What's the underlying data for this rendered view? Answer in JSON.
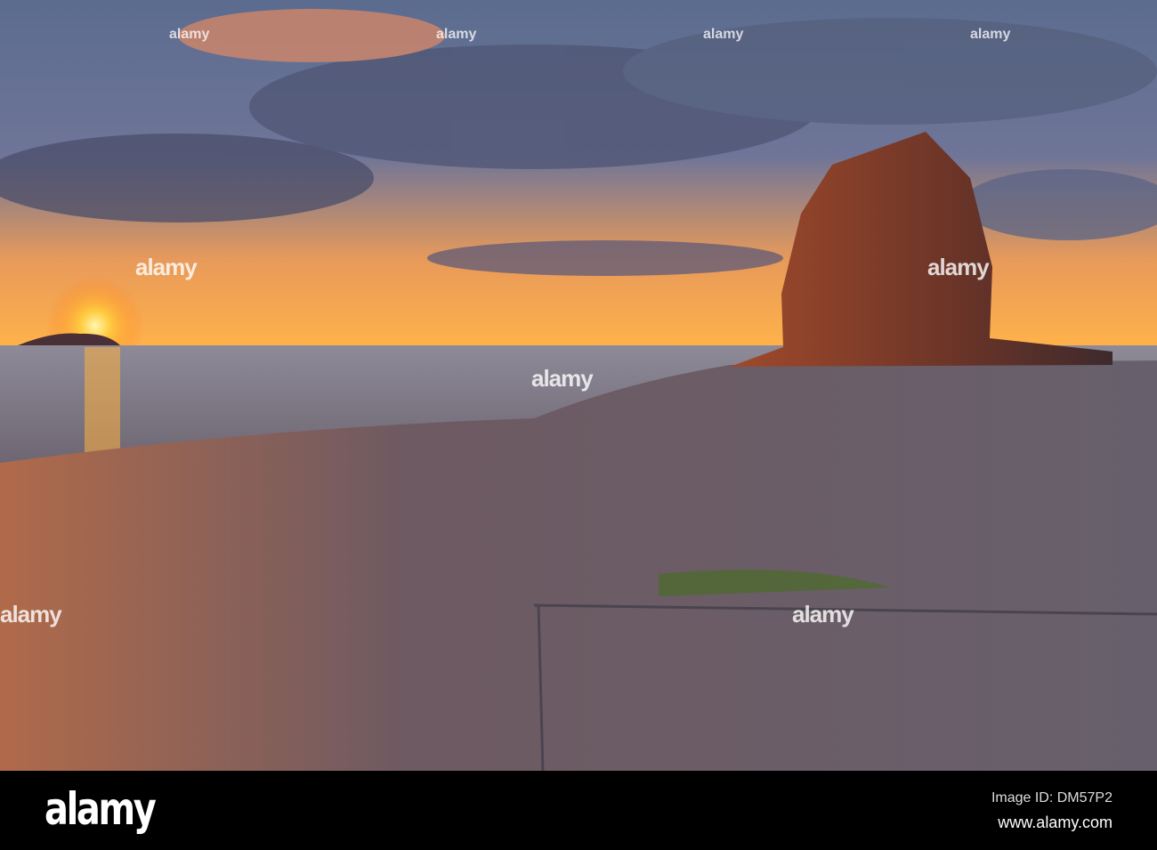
{
  "footer": {
    "logo": "alamy",
    "image_id": "Image ID: DM57P2",
    "website": "www.alamy.com"
  },
  "watermark": "alamy",
  "colors": {
    "sun": "#ffd040",
    "sky_top": "#5a6a8c",
    "rock": "#7a3a2a",
    "shore": "#6e5f6a"
  }
}
